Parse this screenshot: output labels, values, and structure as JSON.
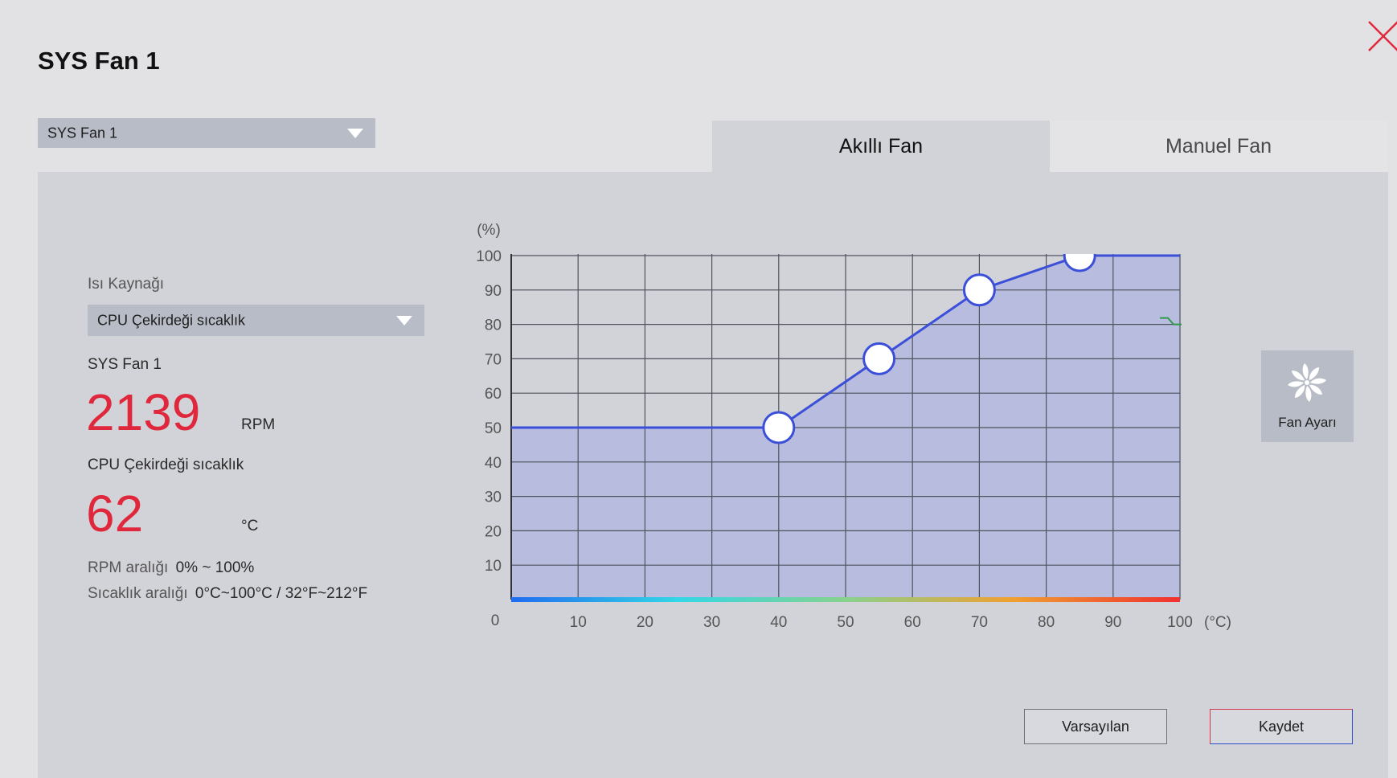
{
  "window": {
    "title": "SYS Fan 1",
    "close_icon": "close-icon",
    "close_color": "#e0283c"
  },
  "fan_select": {
    "value": "SYS Fan 1",
    "icon": "chevron-down-icon"
  },
  "tabs": [
    {
      "label": "Akıllı Fan",
      "active": true
    },
    {
      "label": "Manuel Fan",
      "active": false
    }
  ],
  "left": {
    "heat_source_label": "Isı Kaynağı",
    "heat_source_value": "CPU Çekirdeği sıcaklık",
    "fan_label": "SYS Fan 1",
    "rpm_value": "2139",
    "rpm_unit": "RPM",
    "temp_label": "CPU Çekirdeği sıcaklık",
    "temp_value": "62",
    "temp_unit": "°C",
    "rpm_range_label": "RPM aralığı",
    "rpm_range_value": "0% ~ 100%",
    "temp_range_label": "Sıcaklık aralığı",
    "temp_range_value": "0°C~100°C / 32°F~212°F",
    "value_color": "#e0283c"
  },
  "chart_data": {
    "type": "line",
    "ylabel": "(%)",
    "xlabel": "(°C)",
    "xlim": [
      0,
      100
    ],
    "ylim": [
      0,
      100
    ],
    "x_ticks": [
      10,
      20,
      30,
      40,
      50,
      60,
      70,
      80,
      90,
      100
    ],
    "y_ticks": [
      10,
      20,
      30,
      40,
      50,
      60,
      70,
      80,
      90,
      100
    ],
    "origin_label": "0",
    "grid": true,
    "series": [
      {
        "x": [
          0,
          40
        ],
        "y": [
          50,
          50
        ]
      },
      {
        "x": [
          40,
          55,
          70,
          85,
          100
        ],
        "y": [
          50,
          70,
          90,
          100,
          100
        ]
      }
    ],
    "control_points": [
      {
        "x": 40,
        "y": 50
      },
      {
        "x": 55,
        "y": 70
      },
      {
        "x": 70,
        "y": 90
      },
      {
        "x": 85,
        "y": 100
      }
    ],
    "current_temp_marker": {
      "y": 80
    },
    "colors": {
      "line": "#3b4fd8",
      "fill": "#b4b8e0",
      "gradient": [
        "#1f6cf0",
        "#33d7e6",
        "#88d28e",
        "#f0a030",
        "#f03030"
      ],
      "marker": "#2e9a47"
    }
  },
  "fan_tuning_button": {
    "label": "Fan Ayarı",
    "icon": "fan-icon"
  },
  "buttons": {
    "default": "Varsayılan",
    "save": "Kaydet"
  }
}
